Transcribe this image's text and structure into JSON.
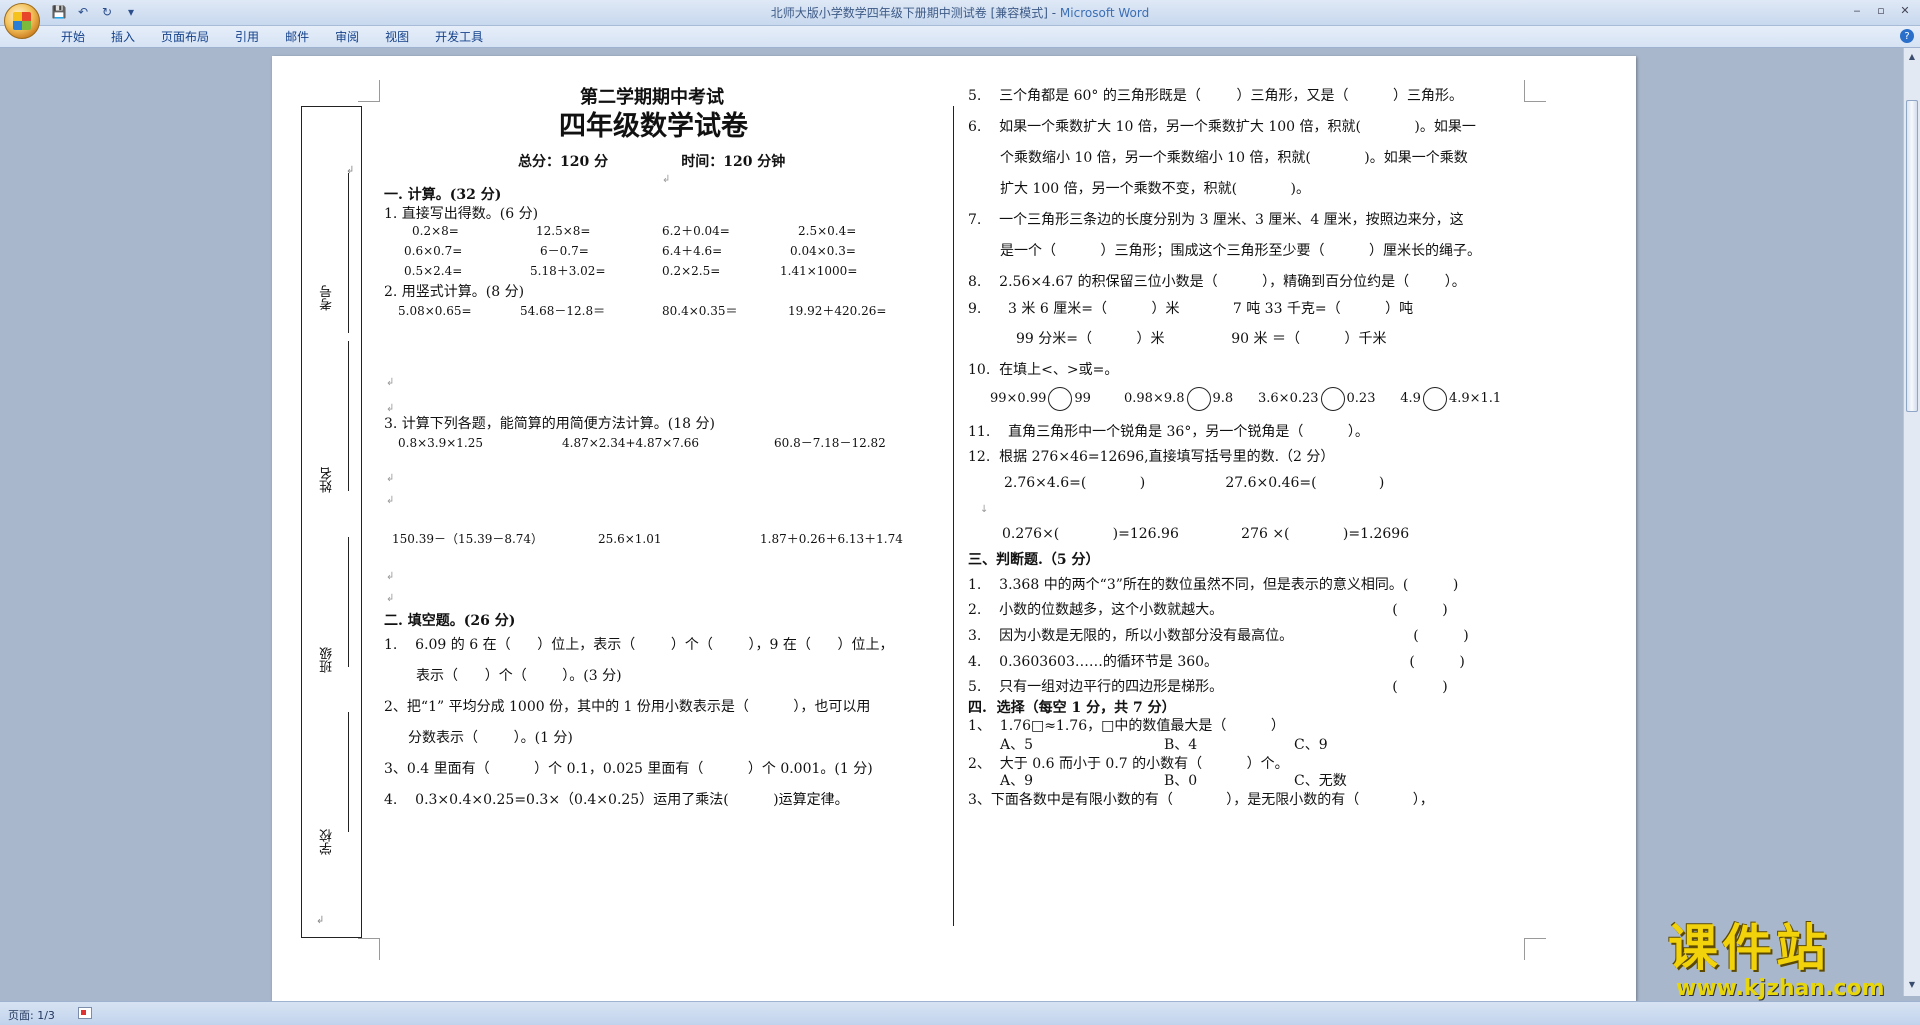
{
  "window": {
    "title": "北师大版小学数学四年级下册期中测试卷 [兼容模式] - ",
    "app_name": "Microsoft Word",
    "min": "‒",
    "max": "▫",
    "close": "✕"
  },
  "qat": {
    "save": "💾",
    "undo": "↶",
    "redo": "↻",
    "more": "▾"
  },
  "ribbon": {
    "tabs": [
      "开始",
      "插入",
      "页面布局",
      "引用",
      "邮件",
      "审阅",
      "视图",
      "开发工具"
    ],
    "help": "?"
  },
  "status": {
    "page": "页面: 1/3"
  },
  "scroll": {
    "up": "▲",
    "down": "▼"
  },
  "binding": {
    "labels": [
      "考号",
      "姓名",
      "班级",
      "学校"
    ]
  },
  "left": {
    "title": "第二学期期中考试",
    "subtitle": "四年级数学试卷",
    "meta": "总分：120 分               时间：120 分钟",
    "s1": "一. 计算。(32 分)",
    "q1": "1. 直接写出得数。(6 分)",
    "q1r1": [
      "0.2×8=",
      "12.5×8=",
      "6.2＋0.04=",
      "2.5×0.4="
    ],
    "q1r2": [
      "0.6×0.7=",
      "6－0.7=",
      "6.4＋4.6=",
      "0.04×0.3="
    ],
    "q1r3": [
      "0.5×2.4=",
      "5.18＋3.02=",
      "0.2×2.5=",
      "1.41×1000="
    ],
    "q2": "2. 用竖式计算。(8 分)",
    "q2r": [
      "5.08×0.65=",
      "54.68－12.8＝",
      "80.4×0.35＝",
      "19.92＋420.26="
    ],
    "q3": "3. 计算下列各题，能简算的用简便方法计算。(18 分)",
    "q3r1": [
      "0.8×3.9×1.25",
      "4.87×2.34+4.87×7.66",
      "60.8－7.18－12.82"
    ],
    "q3r2": [
      "150.39－（15.39－8.74）",
      "25.6×1.01",
      "1.87＋0.26＋6.13＋1.74"
    ],
    "s2": "二. 填空题。(26 分)",
    "f1a": "1.    6.09 的 6 在（      ）位上，表示（        ）个（        ），9 在（      ）位上，",
    "f1b": "表示（      ）个（        ）。(3 分)",
    "f2a": "2、把“1” 平均分成 1000 份，其中的 1 份用小数表示是（          ），也可以用",
    "f2b": "分数表示（        ）。(1 分)",
    "f3": "3、0.4 里面有（          ）个 0.1，0.025 里面有（          ）个 0.001。(1 分)",
    "f4": "4.    0.3×0.4×0.25=0.3×（0.4×0.25）运用了乘法(          )运算定律。"
  },
  "right": {
    "r5": "5.    三个角都是 60° 的三角形既是（        ）三角形，又是（          ）三角形。",
    "r6a": "6.    如果一个乘数扩大 10 倍，另一个乘数扩大 100 倍，积就(            )。如果一",
    "r6b": "个乘数缩小 10 倍，另一个乘数缩小 10 倍，积就(            )。如果一个乘数",
    "r6c": "扩大 100 倍，另一个乘数不变，积就(            )。",
    "r7a": "7.    一个三角形三条边的长度分别为 3 厘米、3 厘米、4 厘米，按照边来分，这",
    "r7b": "是一个（          ）三角形；围成这个三角形至少要（          ）厘米长的绳子。",
    "r8": "8.    2.56×4.67 的积保留三位小数是（          ），精确到百分位约是（        ）。",
    "r9a": "9.      3 米 6 厘米=（          ）米            7 吨 33 千克=（          ）吨",
    "r9b": "99 分米=（          ）米               90 米 ＝（          ）千米",
    "r10": "10.  在填上<、>或=。",
    "r10c": [
      "99×0.99",
      "99",
      "0.98×9.8",
      "9.8",
      "3.6×0.23",
      "0.23",
      "4.9",
      "4.9×1.1"
    ],
    "r11": "11.    直角三角形中一个锐角是 36°，另一个锐角是（          ）。",
    "r12": "12.  根据 276×46=12696,直接填写括号里的数.（2 分）",
    "r12a": "2.76×4.6=(            )                  27.6×0.46=(              )",
    "r12b": "0.276×(            )=126.96              276 ×(            )=1.2696",
    "s3": "三、判断题.（5 分）",
    "j1": "1.    3.368 中的两个“3”所在的数位虽然不同，但是表示的意义相同。(          )",
    "j2": "2.    小数的位数越多，这个小数就越大。                                      (          )",
    "j3": "3.    因为小数是无限的，所以小数部分没有最高位。                           (          )",
    "j4": "4.    0.3603603……的循环节是 360。                                           (          )",
    "j5": "5.    只有一组对边平行的四边形是梯形。                                      (          )",
    "s4": "四.  选择（每空 1 分，共 7 分）",
    "c1": "1、  1.76□≈1.76，□中的数值最大是（          ）",
    "c1o": [
      "A、5",
      "B、4",
      "C、9"
    ],
    "c2": "2、  大于 0.6 而小于 0.7 的小数有（          ）个。",
    "c2o": [
      "A、9",
      "B、0",
      "C、无数"
    ],
    "c3": "3、下面各数中是有限小数的有（            ），是无限小数的有（            ），"
  },
  "watermark": {
    "brand": "课件站",
    "url": "www.kjzhan.com"
  }
}
